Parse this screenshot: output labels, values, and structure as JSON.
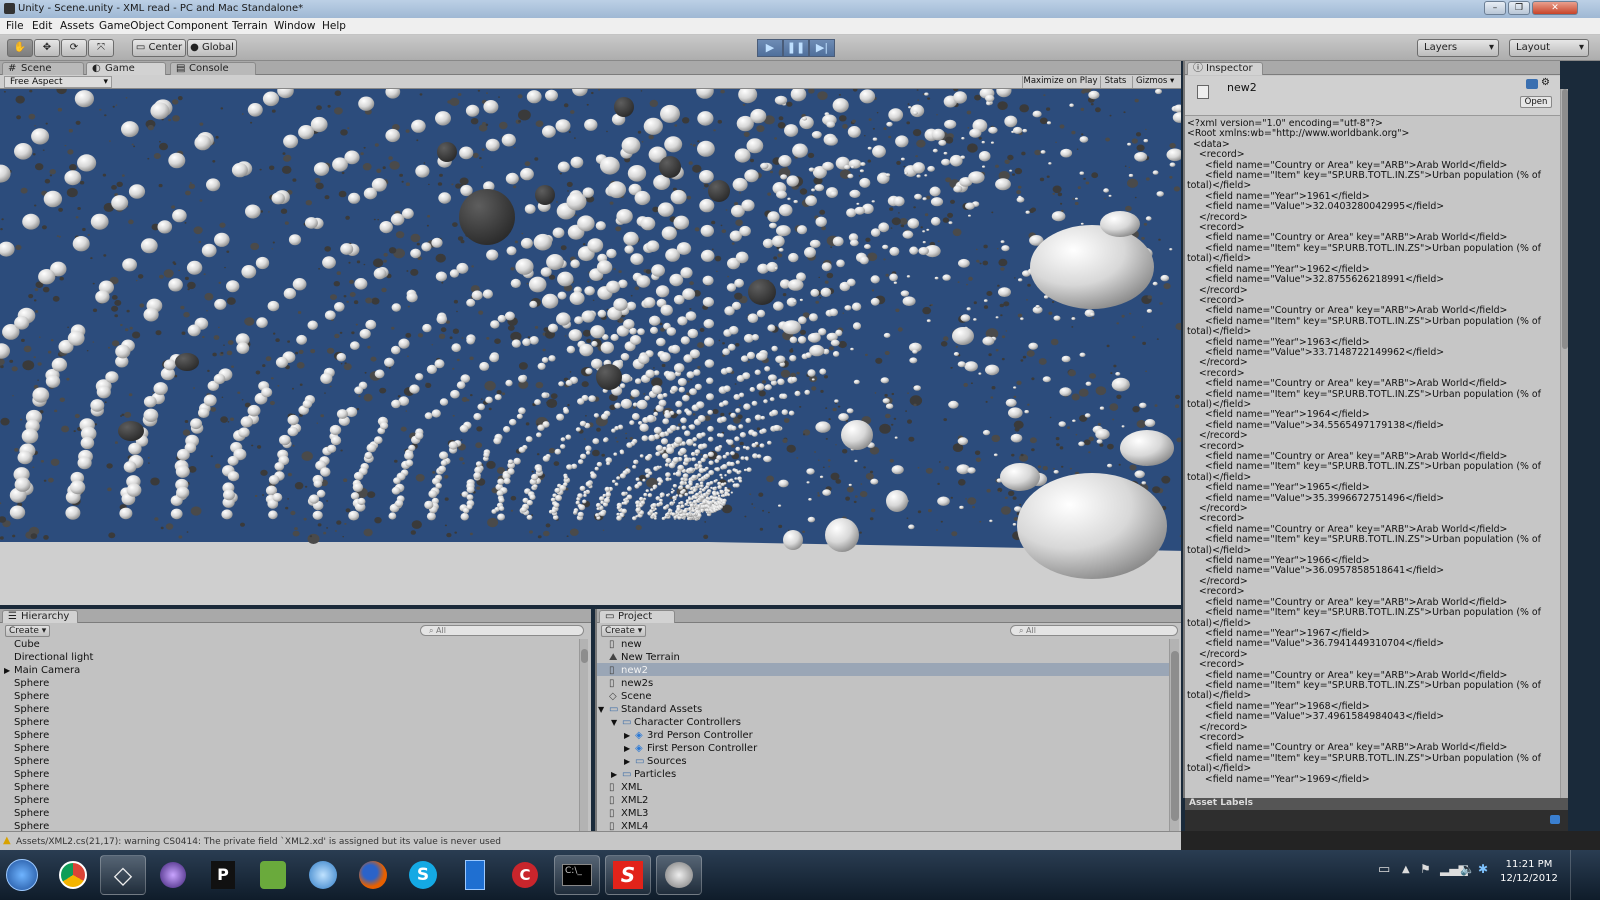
{
  "window": {
    "title": "Unity - Scene.unity - XML read - PC and Mac Standalone*"
  },
  "menu": [
    "File",
    "Edit",
    "Assets",
    "GameObject",
    "Component",
    "Terrain",
    "Window",
    "Help"
  ],
  "toolbar": {
    "pivot": "Center",
    "space": "Global",
    "layers": "Layers",
    "layout": "Layout"
  },
  "scene_tabs": [
    "Scene",
    "Game",
    "Console"
  ],
  "game_bar": {
    "aspect": "Free Aspect",
    "maximize": "Maximize on Play",
    "stats": "Stats",
    "gizmos": "Gizmos"
  },
  "hierarchy": {
    "title": "Hierarchy",
    "create": "Create",
    "search": "All",
    "items": [
      "Cube",
      "Directional light",
      "Main Camera",
      "Sphere",
      "Sphere",
      "Sphere",
      "Sphere",
      "Sphere",
      "Sphere",
      "Sphere",
      "Sphere",
      "Sphere",
      "Sphere",
      "Sphere",
      "Sphere"
    ]
  },
  "project": {
    "title": "Project",
    "create": "Create",
    "search": "All",
    "items": [
      {
        "label": "new",
        "indent": 0,
        "icon": "script"
      },
      {
        "label": "New Terrain",
        "indent": 0,
        "icon": "terrain"
      },
      {
        "label": "new2",
        "indent": 0,
        "icon": "script",
        "selected": true
      },
      {
        "label": "new2s",
        "indent": 0,
        "icon": "script"
      },
      {
        "label": "Scene",
        "indent": 0,
        "icon": "unity"
      },
      {
        "label": "Standard Assets",
        "indent": 0,
        "icon": "folder",
        "arrow": "open"
      },
      {
        "label": "Character Controllers",
        "indent": 1,
        "icon": "folder",
        "arrow": "open"
      },
      {
        "label": "3rd Person Controller",
        "indent": 2,
        "icon": "prefab",
        "arrow": "closed"
      },
      {
        "label": "First Person Controller",
        "indent": 2,
        "icon": "prefab",
        "arrow": "closed"
      },
      {
        "label": "Sources",
        "indent": 2,
        "icon": "folder",
        "arrow": "closed"
      },
      {
        "label": "Particles",
        "indent": 1,
        "icon": "folder",
        "arrow": "closed"
      },
      {
        "label": "XML",
        "indent": 0,
        "icon": "script"
      },
      {
        "label": "XML2",
        "indent": 0,
        "icon": "script"
      },
      {
        "label": "XML3",
        "indent": 0,
        "icon": "script"
      },
      {
        "label": "XML4",
        "indent": 0,
        "icon": "script"
      }
    ]
  },
  "inspector": {
    "tab": "Inspector",
    "asset_name": "new2",
    "open_button": "Open",
    "asset_labels": "Asset Labels",
    "xml_header": [
      "<?xml version=\"1.0\" encoding=\"utf-8\"?>",
      "<Root xmlns:wb=\"http://www.worldbank.org\">",
      "  <data>"
    ],
    "country_line": "      <field name=\"Country or Area\" key=\"ARB\">Arab World</field>",
    "item_line": "      <field name=\"Item\" key=\"SP.URB.TOTL.IN.ZS\">Urban population (% of",
    "item_cont": "total)</field>",
    "records": [
      {
        "year": "1961",
        "value": "32.0403280042995"
      },
      {
        "year": "1962",
        "value": "32.8755626218991"
      },
      {
        "year": "1963",
        "value": "33.7148722149962"
      },
      {
        "year": "1964",
        "value": "34.5565497179138"
      },
      {
        "year": "1965",
        "value": "35.3996672751496"
      },
      {
        "year": "1966",
        "value": "36.0957858518641"
      },
      {
        "year": "1967",
        "value": "36.7941449310704"
      },
      {
        "year": "1968",
        "value": "37.4961584984043"
      },
      {
        "year": "1969",
        "value": ""
      }
    ]
  },
  "status": {
    "message": "Assets/XML2.cs(21,17): warning CS0414: The private field `XML2.xd' is assigned but its value is never used"
  },
  "clock": {
    "time": "11:21 PM",
    "date": "12/12/2012"
  }
}
